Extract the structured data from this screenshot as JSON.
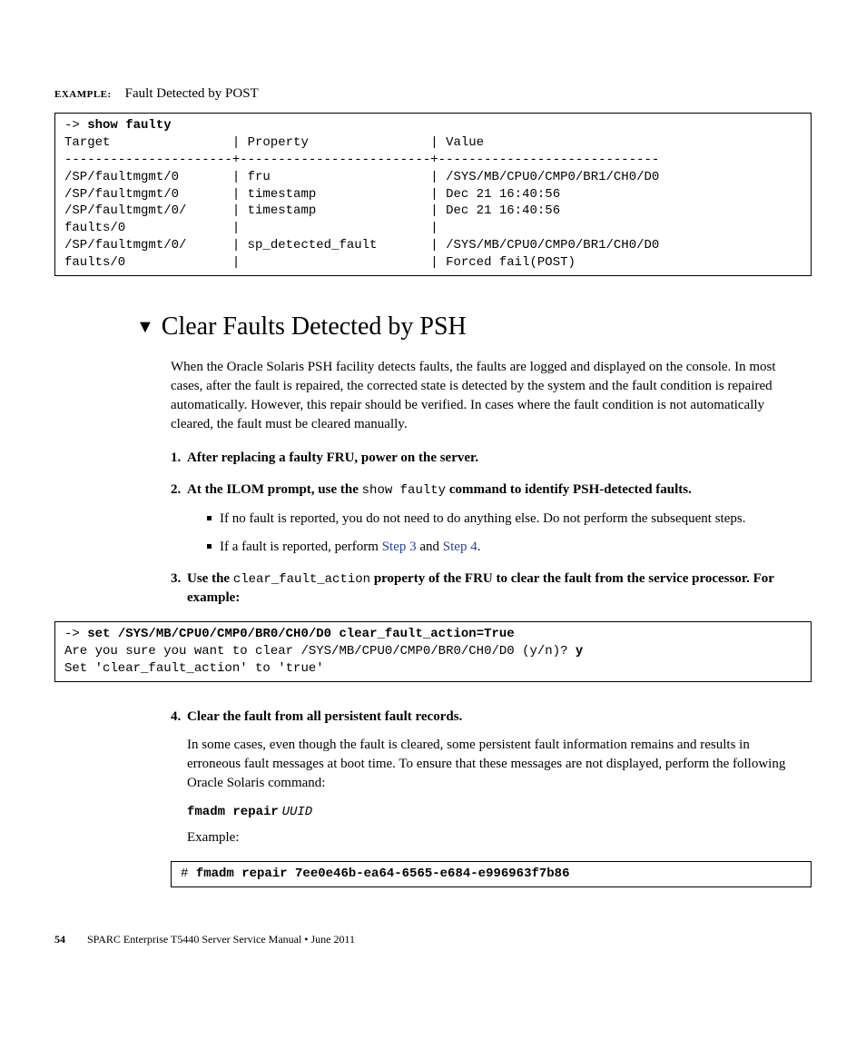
{
  "example": {
    "label": "EXAMPLE:",
    "title": "Fault Detected by POST"
  },
  "code_block_1": "-> <b>show faulty</b>\nTarget                | Property                | Value\n----------------------+-------------------------+-----------------------------\n/SP/faultmgmt/0       | fru                     | /SYS/MB/CPU0/CMP0/BR1/CH0/D0\n/SP/faultmgmt/0       | timestamp               | Dec 21 16:40:56\n/SP/faultmgmt/0/      | timestamp               | Dec 21 16:40:56\nfaults/0              |                         |\n/SP/faultmgmt/0/      | sp_detected_fault       | /SYS/MB/CPU0/CMP0/BR1/CH0/D0\nfaults/0              |                         | Forced fail(POST)",
  "section_heading": "Clear Faults Detected by PSH",
  "intro_para": "When the Oracle Solaris PSH facility detects faults, the faults are logged and displayed on the console. In most cases, after the fault is repaired, the corrected state is detected by the system and the fault condition is repaired automatically. However, this repair should be verified. In cases where the fault condition is not automatically cleared, the fault must be cleared manually.",
  "steps": {
    "s1": "After replacing a faulty FRU, power on the server.",
    "s2_pre": "At the ILOM prompt, use the ",
    "s2_cmd": "show faulty",
    "s2_post": " command to identify PSH-detected faults.",
    "s2_bullet1": "If no fault is reported, you do not need to do anything else. Do not perform the subsequent steps.",
    "s2_bullet2_pre": "If a fault is reported, perform ",
    "s2_bullet2_link1": "Step 3",
    "s2_bullet2_mid": " and ",
    "s2_bullet2_link2": "Step 4",
    "s2_bullet2_end": ".",
    "s3_pre": "Use the ",
    "s3_cmd": "clear_fault_action",
    "s3_post": " property of the FRU to clear the fault from the service processor. For example:",
    "s4_title": "Clear the fault from all persistent fault records.",
    "s4_para": "In some cases, even though the fault is cleared, some persistent fault information remains and results in erroneous fault messages at boot time. To ensure that these messages are not displayed, perform the following Oracle Solaris command:",
    "s4_cmd": "fmadm repair",
    "s4_arg": "UUID",
    "s4_example_label": "Example:"
  },
  "code_block_2": "-> <b>set /SYS/MB/CPU0/CMP0/BR0/CH0/D0 clear_fault_action=True</b>\nAre you sure you want to clear /SYS/MB/CPU0/CMP0/BR0/CH0/D0 (y/n)? <b>y</b>\nSet 'clear_fault_action' to 'true'",
  "code_block_3": "# <b>fmadm repair 7ee0e46b-ea64-6565-e684-e996963f7b86</b>",
  "footer": {
    "page": "54",
    "text": "SPARC Enterprise T5440 Server Service Manual • June 2011"
  }
}
